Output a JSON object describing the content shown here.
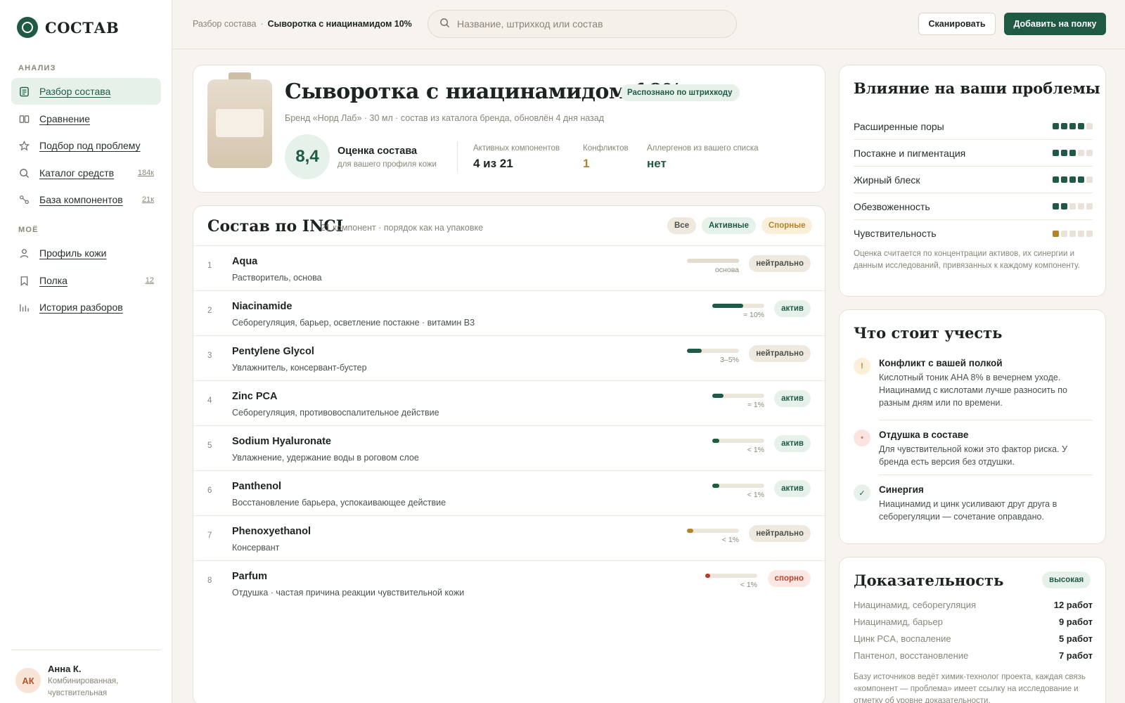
{
  "brand": {
    "name": "СОСТАВ"
  },
  "sidebar": {
    "section_analysis": "АНАЛИЗ",
    "section_mine": "МОЁ",
    "items": [
      {
        "label": "Разбор состава",
        "icon": "document-icon",
        "count": ""
      },
      {
        "label": "Сравнение",
        "icon": "columns-icon",
        "count": ""
      },
      {
        "label": "Подбор под проблему",
        "icon": "star-icon",
        "count": ""
      },
      {
        "label": "Каталог средств",
        "icon": "search-icon",
        "count": "184к"
      },
      {
        "label": "База компонентов",
        "icon": "molecule-icon",
        "count": "21к"
      },
      {
        "label": "Профиль кожи",
        "icon": "user-icon",
        "count": ""
      },
      {
        "label": "Полка",
        "icon": "bookmark-icon",
        "count": "12"
      },
      {
        "label": "История разборов",
        "icon": "bar-chart-icon",
        "count": ""
      }
    ],
    "user": {
      "initials": "АК",
      "name": "Анна К.",
      "desc": "Комбинированная, чувствительная"
    }
  },
  "topbar": {
    "breadcrumb_root": "Разбор состава",
    "breadcrumb_sep": "·",
    "breadcrumb_current": "Сыворотка с ниацинамидом 10%",
    "search_placeholder": "Название, штрихкод или состав",
    "scan_label": "Сканировать",
    "add_label": "Добавить на полку"
  },
  "product": {
    "title": "Сыворотка с ниацинамидом 10%",
    "badge": "Распознано по штрихкоду",
    "meta": "Бренд «Норд Лаб» · 30 мл · состав из каталога бренда, обновлён 4 дня назад",
    "score": "8,4",
    "score_title": "Оценка состава",
    "score_sub": "для вашего профиля кожи",
    "stats": [
      {
        "label": "Активных компонентов",
        "value": "4 из 21",
        "color": "#1d2420"
      },
      {
        "label": "Конфликтов",
        "value": "1",
        "color": "#b5822a"
      },
      {
        "label": "Аллергенов из вашего списка",
        "value": "нет",
        "color": "#1f5a45"
      }
    ]
  },
  "inci": {
    "title": "Состав по INCI",
    "subtitle": "21 компонент · порядок как на упаковке",
    "filters": [
      "Все",
      "Активные",
      "Спорные"
    ],
    "rows": [
      {
        "n": "1",
        "name": "Aqua",
        "desc": "Растворитель, основа",
        "level": 1.0,
        "bar_color": "#e3dccd",
        "conc": "основа",
        "tag": "нейтрально",
        "kind": "neutral"
      },
      {
        "n": "2",
        "name": "Niacinamide",
        "desc": "Себорегуляция, барьер, осветление постакне · витамин B3",
        "level": 0.6,
        "bar_color": "#1f5a45",
        "conc": "≈ 10%",
        "tag": "актив",
        "kind": "active"
      },
      {
        "n": "3",
        "name": "Pentylene Glycol",
        "desc": "Увлажнитель, консервант-бустер",
        "level": 0.28,
        "bar_color": "#1f5a45",
        "conc": "3–5%",
        "tag": "нейтрально",
        "kind": "neutral"
      },
      {
        "n": "4",
        "name": "Zinc PCA",
        "desc": "Себорегуляция, противовоспалительное действие",
        "level": 0.22,
        "bar_color": "#1f5a45",
        "conc": "≈ 1%",
        "tag": "актив",
        "kind": "active"
      },
      {
        "n": "5",
        "name": "Sodium Hyaluronate",
        "desc": "Увлажнение, удержание воды в роговом слое",
        "level": 0.14,
        "bar_color": "#1f5a45",
        "conc": "< 1%",
        "tag": "актив",
        "kind": "active"
      },
      {
        "n": "6",
        "name": "Panthenol",
        "desc": "Восстановление барьера, успокаивающее действие",
        "level": 0.14,
        "bar_color": "#1f5a45",
        "conc": "< 1%",
        "tag": "актив",
        "kind": "active"
      },
      {
        "n": "7",
        "name": "Phenoxyethanol",
        "desc": "Консервант",
        "level": 0.12,
        "bar_color": "#b5822a",
        "conc": "< 1%",
        "tag": "нейтрально",
        "kind": "neutral"
      },
      {
        "n": "8",
        "name": "Parfum",
        "desc": "Отдушка · частая причина реакции чувствительной кожи",
        "level": 0.1,
        "bar_color": "#c0392b",
        "conc": "< 1%",
        "tag": "спорно",
        "kind": "disputed"
      }
    ]
  },
  "impact": {
    "title": "Влияние на ваши проблемы",
    "rows": [
      {
        "label": "Расширенные поры",
        "score": 4,
        "color": "#1f5a45"
      },
      {
        "label": "Постакне и пигментация",
        "score": 3,
        "color": "#1f5a45"
      },
      {
        "label": "Жирный блеск",
        "score": 4,
        "color": "#1f5a45"
      },
      {
        "label": "Обезвоженность",
        "score": 2,
        "color": "#1f5a45"
      },
      {
        "label": "Чувствительность",
        "score": 1,
        "color": "#b5822a"
      }
    ],
    "note": "Оценка считается по концентрации активов, их синергии и данным исследований, привязанных к каждому компоненту."
  },
  "concerns": {
    "title": "Что стоит учесть",
    "items": [
      {
        "icon": "!",
        "icon_name": "warning-icon",
        "bg": "#fbefd9",
        "fg": "#b5822a",
        "title": "Конфликт с вашей полкой",
        "desc": "Кислотный тоник AHA 8% в вечернем уходе. Ниацинамид с кислотами лучше разносить по разным дням или по времени."
      },
      {
        "icon": "•",
        "icon_name": "alert-dot-icon",
        "bg": "#fbe4e0",
        "fg": "#d9776a",
        "title": "Отдушка в составе",
        "desc": "Для чувствительной кожи это фактор риска. У бренда есть версия без отдушки."
      },
      {
        "icon": "✓",
        "icon_name": "check-icon",
        "bg": "#e6f1ea",
        "fg": "#1f5a45",
        "title": "Синергия",
        "desc": "Ниацинамид и цинк усиливают друг друга в себорегуляции — сочетание оправдано."
      }
    ]
  },
  "evidence": {
    "title": "Доказательность",
    "badge": "высокая",
    "rows": [
      {
        "label": "Ниацинамид, себорегуляция",
        "value": "12 работ"
      },
      {
        "label": "Ниацинамид, барьер",
        "value": "9 работ"
      },
      {
        "label": "Цинк PCA, воспаление",
        "value": "5 работ"
      },
      {
        "label": "Пантенол, восстановление",
        "value": "7 работ"
      }
    ],
    "note": "Базу источников ведёт химик-технолог проекта, каждая связь «компонент — проблема» имеет ссылку на исследование и отметку об уровне доказательности."
  }
}
